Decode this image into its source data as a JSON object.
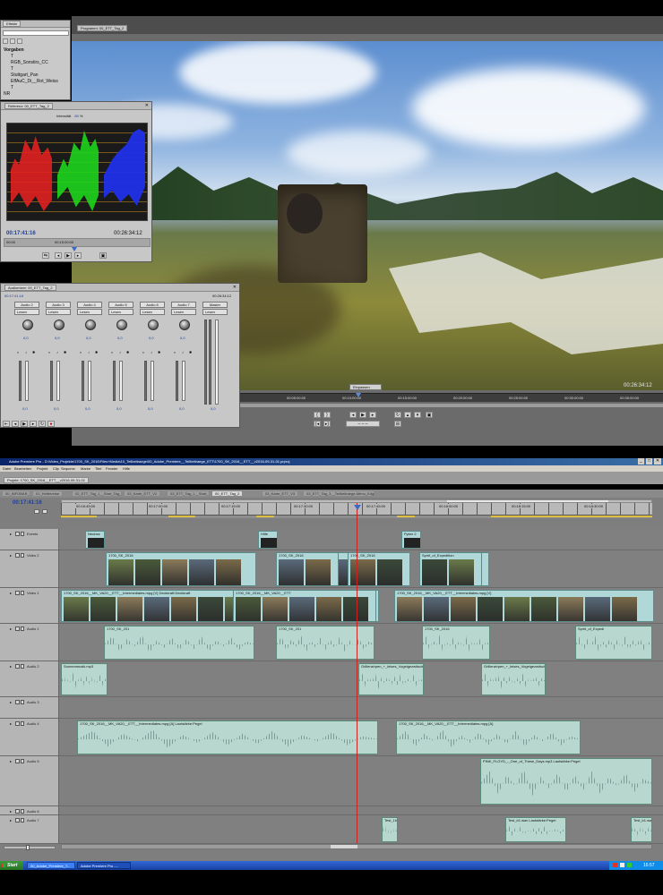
{
  "effects_panel": {
    "title": "Effekte",
    "tree": [
      "Vorgaben",
      "T",
      "RGB_Sonstirs_CC",
      "T",
      "Stuttgart_Pan",
      "EffAuC_Di__Rot_Weiss",
      "T",
      "NR"
    ]
  },
  "program_monitor": {
    "tab": "Programm: 00_ETT_Tag_2",
    "zoom": "Einpassen",
    "end_timecode": "00:26:34:12",
    "ruler": [
      "00:00",
      "00:05:00:00",
      "00:10:00:00",
      "00:15:00:00",
      "00:20:00:00",
      "00:25:00:00",
      "00:30:00:00",
      "00:35:00:00"
    ]
  },
  "reference_monitor": {
    "tab": "Referenz: 00_ETT_Tag_2",
    "mode_label": "Intensität",
    "mode_value": "80",
    "mode_unit": "%",
    "current_timecode": "00:17:41:16",
    "end_timecode": "00:26:34:12",
    "ruler": [
      "00:00",
      "00:15:00:00"
    ]
  },
  "audio_mixer": {
    "tab": "Audiomixer: 00_ETT_Tag_2",
    "current_timecode": "00:17:41:16",
    "end_timecode": "00:26:34:12",
    "channels": [
      {
        "name": "Audio 2",
        "mode": "Lesen",
        "value": "0,0"
      },
      {
        "name": "Audio 3",
        "mode": "Lesen",
        "value": "0,0"
      },
      {
        "name": "Audio 4",
        "mode": "Lesen",
        "value": "0,0"
      },
      {
        "name": "Audio 5",
        "mode": "Lesen",
        "value": "0,0"
      },
      {
        "name": "Audio 6",
        "mode": "Lesen",
        "value": "0,0"
      },
      {
        "name": "Audio 7",
        "mode": "Lesen",
        "value": "0,0"
      },
      {
        "name": "Master",
        "mode": "Lesen",
        "value": "0,0"
      }
    ]
  },
  "app": {
    "title": "Adobe Premiere Pro - D:\\Video_Projekte\\1700_SK_2016\\Files+Media\\10_Teilbeitraege\\00_Adobe_Premiere__Teilbeitraege_ETT\\1700_SK_2016__ETT__v2016-09-31-01.prproj",
    "menu": [
      "Datei",
      "Bearbeiten",
      "Projekt",
      "Clip",
      "Sequenz",
      "Marke",
      "Titel",
      "Fenster",
      "Hilfe"
    ],
    "project_tab": "Projekt: 1700_SK_2016__ETT__v2016-09-31-01"
  },
  "timeline": {
    "sequence_tabs": [
      "00_INFOBAR_ETT",
      "01_Helferreise",
      "02_ETT_Tag_1__Start_Tag_1",
      "03_Karte_ETT_V2",
      "03_ETT_Tag_1__Start_Tag_1",
      "00_ETT_Tag_2",
      "03_Karte_ETT_V3",
      "03_ETT_Tag_3__Teilbeitraege-Menu_Edge"
    ],
    "current_timecode": "00:17:41:16",
    "ruler": [
      "00:16:45:00",
      "00:17:00:00",
      "00:17:15:00",
      "00:17:30:00",
      "00:17:45:00",
      "00:18:00:00",
      "00:18:15:00",
      "00:18:30:00"
    ],
    "video_tracks": [
      {
        "name": "Events",
        "clips": [
          "Neubez",
          "Hilfe",
          "Pyker 2"
        ]
      },
      {
        "name": "Video 2",
        "clips": [
          "1700_SK_2016",
          "1700_SK_2016",
          "1700_SK_2016",
          "1700_SK_2016",
          "1700_SK_2016",
          "Spirit_of_Expedition"
        ]
      },
      {
        "name": "Video 1",
        "clips": [
          "1700_SK_2016__MK_VA20__ETT__Intermediates.mpg [V] Deckkraft:Deckkraft",
          "1700_SK_2016__MK_VA20__ETT",
          "1700_SK_2016__MK_VA20__ETT__Intermediates.mpg [V]"
        ]
      }
    ],
    "audio_tracks": [
      {
        "name": "Audio 1",
        "clips": [
          "1700_SK_201",
          "1700_SK_201",
          "1700_SK_2016",
          "Spirit_of_Expedi"
        ]
      },
      {
        "name": "Audio 2",
        "clips": [
          "Sonnenmusik.mp3",
          "Grillenzirpen_+_leises_Vogelgezwitsch",
          "Grillenzirpen_+_leises_Vogelgezwitsch"
        ]
      },
      {
        "name": "Audio 3",
        "clips": []
      },
      {
        "name": "Audio 4",
        "clips": [
          "1700_SK_2016__MK_VA20__ETT__Intermediates.mpg [A] Lautstärke:Pegel",
          "1700_SK_2016__MK_VA20__ETT__Intermediates.mpg [A]"
        ]
      },
      {
        "name": "Audio 5",
        "clips": [
          "PINK_FLOYD_-_One_of_These_Days.mp3 Lautstärke:Pegel"
        ]
      },
      {
        "name": "Audio 6",
        "clips": []
      },
      {
        "name": "Audio 7",
        "clips": [
          "Test_1h",
          "Test_b1.wav Lautstärke:Pegel",
          "Test_b1.wav"
        ]
      }
    ]
  },
  "taskbar": {
    "start": "Start",
    "items": [
      "00_Adobe_Premiere_T...",
      "Adobe Premiere Pro -..."
    ],
    "clock": "16:57"
  },
  "colors": {
    "accent": "#1c3f9a",
    "title_bar": "#0a246a",
    "clip_video": "#b0d8d8",
    "clip_audio": "#b8d8cf",
    "playhead": "#cc2222"
  }
}
